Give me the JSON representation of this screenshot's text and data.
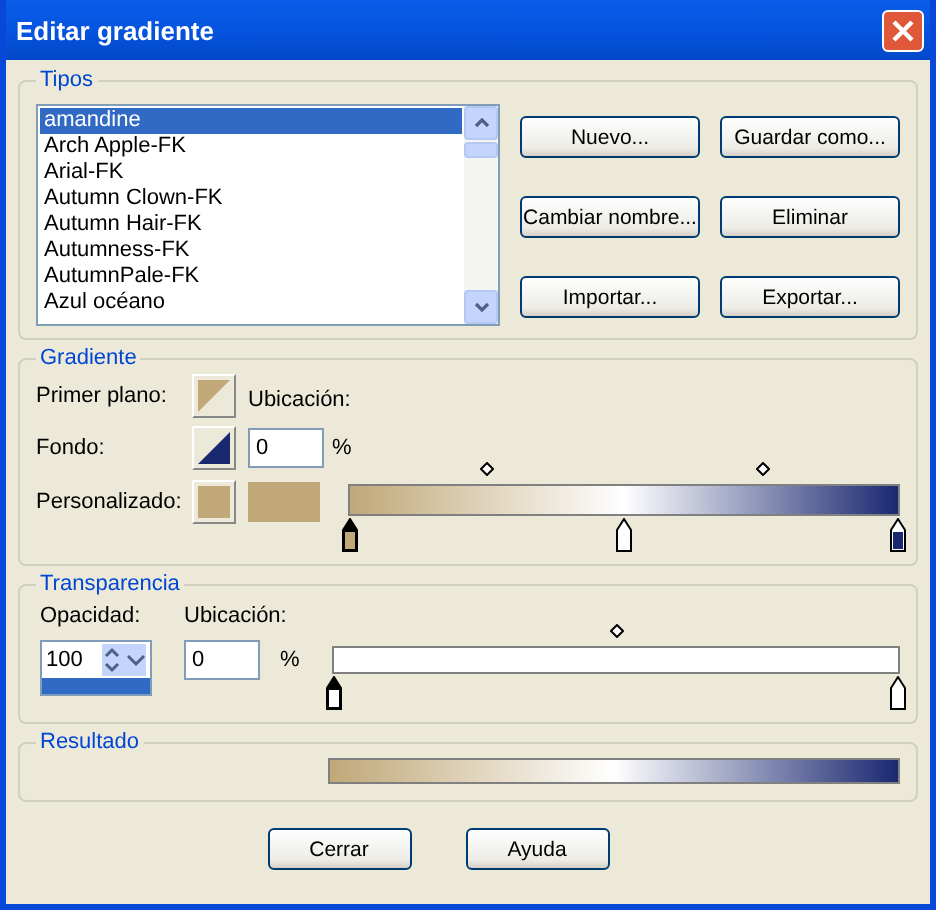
{
  "window": {
    "title": "Editar gradiente"
  },
  "tipos": {
    "legend": "Tipos",
    "items": [
      {
        "label": "amandine",
        "selected": true
      },
      {
        "label": "Arch Apple-FK",
        "selected": false
      },
      {
        "label": "Arial-FK",
        "selected": false
      },
      {
        "label": "Autumn Clown-FK",
        "selected": false
      },
      {
        "label": "Autumn Hair-FK",
        "selected": false
      },
      {
        "label": "Autumness-FK",
        "selected": false
      },
      {
        "label": "AutumnPale-FK",
        "selected": false
      },
      {
        "label": "Azul océano",
        "selected": false
      }
    ],
    "buttons": [
      "Nuevo...",
      "Guardar como...",
      "Cambiar nombre...",
      "Eliminar",
      "Importar...",
      "Exportar..."
    ]
  },
  "gradiente": {
    "legend": "Gradiente",
    "primer_plano_label": "Primer plano:",
    "fondo_label": "Fondo:",
    "personalizado_label": "Personalizado:",
    "ubicacion_label": "Ubicación:",
    "ubicacion_value": "0",
    "percent": "%",
    "stops": [
      {
        "color": "#c0a878",
        "selected": true
      },
      {
        "color": "#ffffff",
        "selected": false
      },
      {
        "color": "#1a2870",
        "selected": false
      }
    ]
  },
  "transparencia": {
    "legend": "Transparencia",
    "opacidad_label": "Opacidad:",
    "opacidad_value": "100",
    "ubicacion_label": "Ubicación:",
    "ubicacion_value": "0",
    "percent": "%",
    "stops": [
      {
        "selected": true
      },
      {
        "selected": false
      }
    ]
  },
  "resultado": {
    "legend": "Resultado"
  },
  "buttons": [
    "Cerrar",
    "Ayuda"
  ]
}
